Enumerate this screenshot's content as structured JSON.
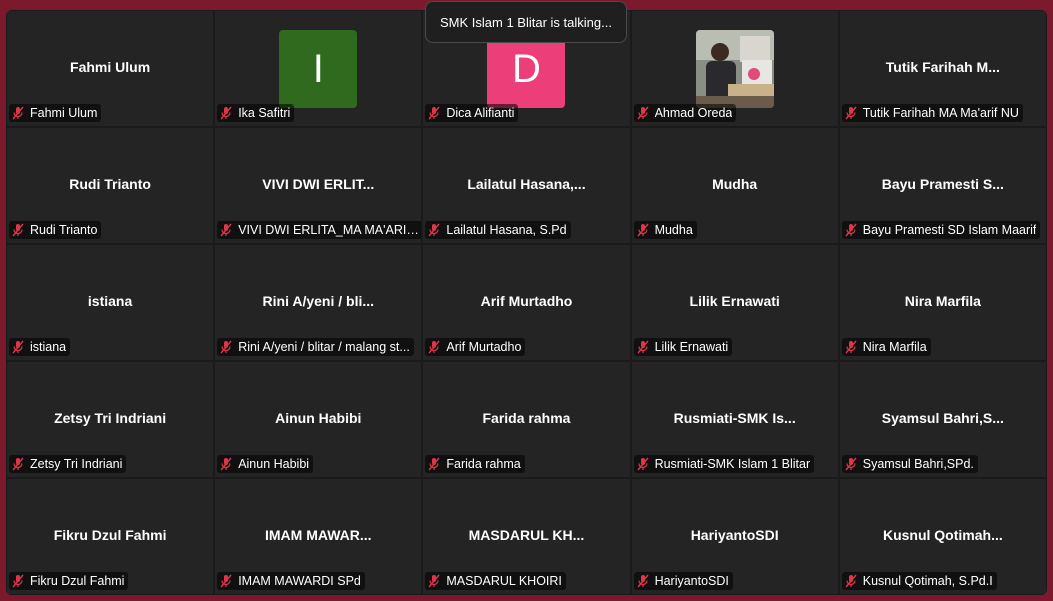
{
  "toast": {
    "text": "SMK Islam 1 Blitar is talking..."
  },
  "colors": {
    "avatar_I": "#2f6a1e",
    "avatar_D": "#ec3f7a",
    "muted": "#e0354a"
  },
  "participants": [
    {
      "title": "Fahmi Ulum",
      "label": "Fahmi Ulum"
    },
    {
      "avatar_letter": "I",
      "label": "Ika Safitri"
    },
    {
      "avatar_letter": "D",
      "label": "Dica Alifianti"
    },
    {
      "label": "Ahmad Oreda"
    },
    {
      "title": "Tutik Farihah M...",
      "label": "Tutik Farihah MA Ma'arif NU"
    },
    {
      "title": "Rudi Trianto",
      "label": "Rudi Trianto"
    },
    {
      "title": "VIVI DWI ERLIT...",
      "label": "VIVI DWI ERLITA_MA MA'ARIF ..."
    },
    {
      "title": "Lailatul  Hasana,...",
      "label": "Lailatul Hasana, S.Pd"
    },
    {
      "title": "Mudha",
      "label": "Mudha"
    },
    {
      "title": "Bayu Pramesti S...",
      "label": "Bayu Pramesti SD Islam Maarif"
    },
    {
      "title": "istiana",
      "label": "istiana"
    },
    {
      "title": "Rini A/yeni / bli...",
      "label": "Rini A/yeni / blitar / malang st..."
    },
    {
      "title": "Arif Murtadho",
      "label": "Arif Murtadho"
    },
    {
      "title": "Lilik Ernawati",
      "label": "Lilik Ernawati"
    },
    {
      "title": "Nira Marfila",
      "label": "Nira Marfila"
    },
    {
      "title": "Zetsy Tri Indriani",
      "label": "Zetsy Tri Indriani"
    },
    {
      "title": "Ainun Habibi",
      "label": "Ainun Habibi"
    },
    {
      "title": "Farida rahma",
      "label": "Farida rahma"
    },
    {
      "title": "Rusmiati-SMK  Is...",
      "label": "Rusmiati-SMK Islam 1 Blitar"
    },
    {
      "title": "Syamsul  Bahri,S...",
      "label": "Syamsul Bahri,SPd."
    },
    {
      "title": "Fikru Dzul Fahmi",
      "label": "Fikru Dzul Fahmi"
    },
    {
      "title": "IMAM  MAWAR...",
      "label": "IMAM MAWARDI SPd"
    },
    {
      "title": "MASDARUL  KH...",
      "label": "MASDARUL KHOIRI"
    },
    {
      "title": "HariyantoSDI",
      "label": "HariyantoSDI"
    },
    {
      "title": "Kusnul  Qotimah...",
      "label": "Kusnul Qotimah, S.Pd.I"
    }
  ]
}
